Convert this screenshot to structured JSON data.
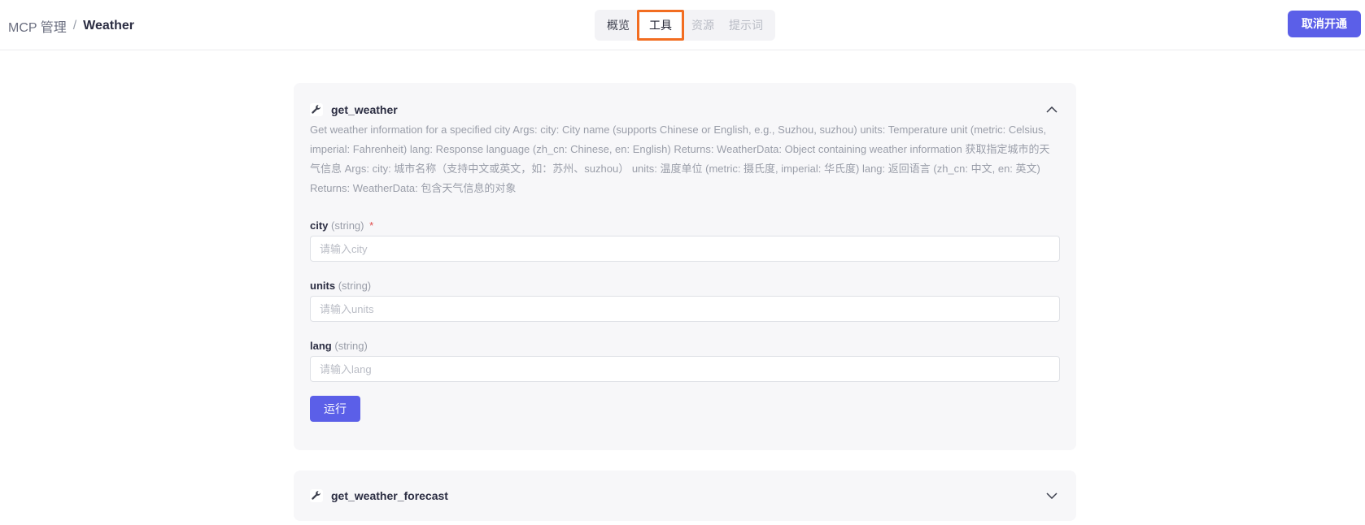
{
  "breadcrumb": {
    "root": "MCP 管理",
    "separator": "/",
    "current": "Weather"
  },
  "tabs": [
    {
      "label": "概览"
    },
    {
      "label": "工具"
    },
    {
      "label": "资源"
    },
    {
      "label": "提示词"
    }
  ],
  "header": {
    "cancel_label": "取消开通"
  },
  "tools": [
    {
      "name": "get_weather",
      "description": "Get weather information for a specified city Args: city: City name (supports Chinese or English, e.g., Suzhou, suzhou) units: Temperature unit (metric: Celsius, imperial: Fahrenheit) lang: Response language (zh_cn: Chinese, en: English) Returns: WeatherData: Object containing weather information 获取指定城市的天气信息 Args: city: 城市名称（支持中文或英文，如：苏州、suzhou） units: 温度单位 (metric: 摄氏度, imperial: 华氏度) lang: 返回语言 (zh_cn: 中文, en: 英文) Returns: WeatherData: 包含天气信息的对象",
      "fields": [
        {
          "name": "city",
          "type": "(string)",
          "required": "*",
          "placeholder": "请输入city"
        },
        {
          "name": "units",
          "type": "(string)",
          "placeholder": "请输入units"
        },
        {
          "name": "lang",
          "type": "(string)",
          "placeholder": "请输入lang"
        }
      ],
      "run_label": "运行"
    },
    {
      "name": "get_weather_forecast"
    }
  ],
  "colors": {
    "accent": "#5b5fe8",
    "active_tab_border": "#f26d21",
    "required": "#e04b4b"
  },
  "icons": {
    "tool": "wrench-icon",
    "expanded": "chevron-up-icon",
    "collapsed": "chevron-down-icon"
  }
}
